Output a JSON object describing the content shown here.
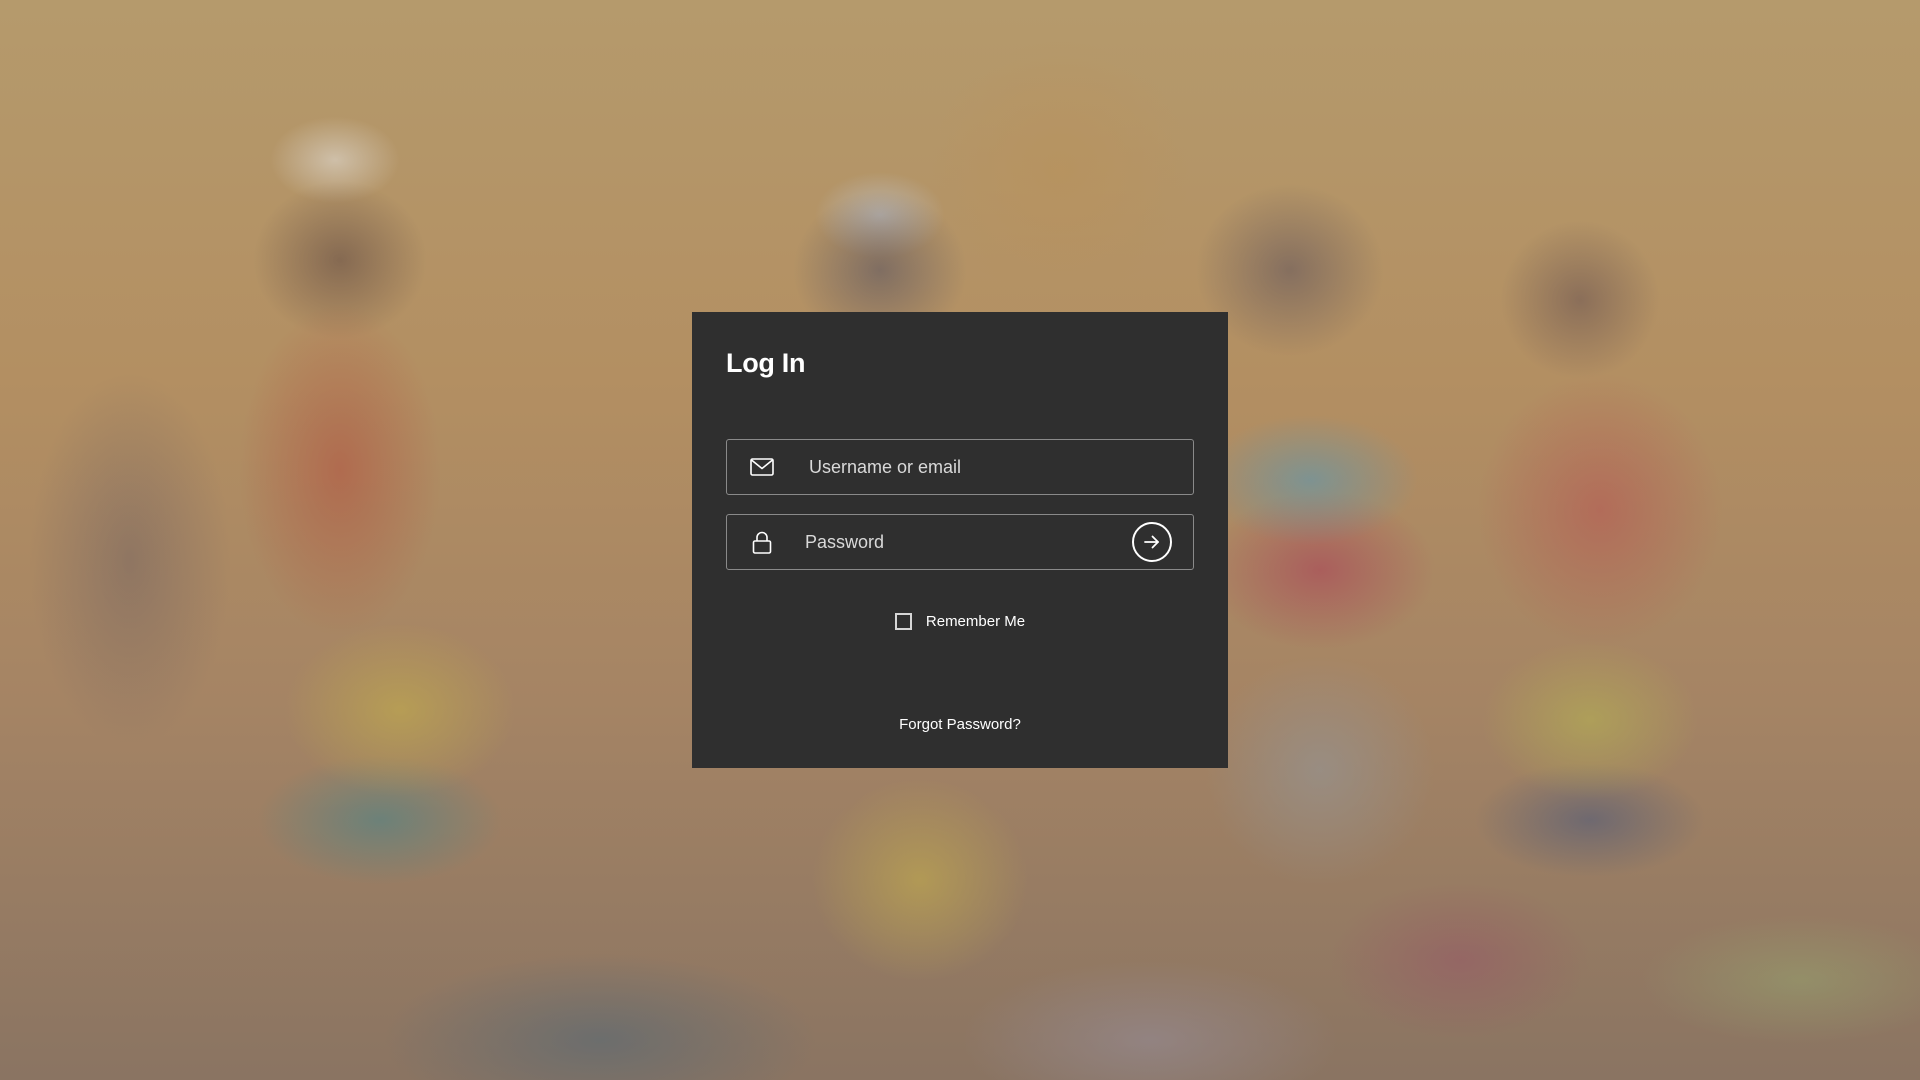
{
  "login": {
    "title": "Log In",
    "username_placeholder": "Username or email",
    "username_value": "",
    "password_placeholder": "Password",
    "password_value": "",
    "remember_label": "Remember Me",
    "remember_checked": false,
    "forgot_label": "Forgot Password?"
  },
  "icons": {
    "username": "envelope-icon",
    "password": "lock-icon",
    "submit": "arrow-right-circle-icon"
  },
  "colors": {
    "card_background": "#2f2f2f",
    "text": "#ffffff",
    "border": "#8a8a8a"
  }
}
